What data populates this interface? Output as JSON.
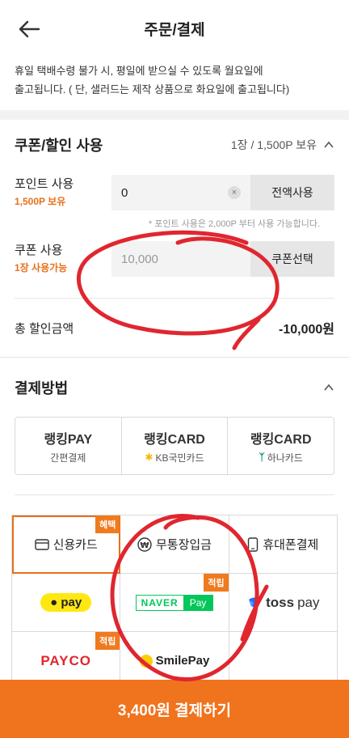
{
  "header": {
    "title": "주문/결제"
  },
  "notice": {
    "line1": "휴일 택배수령 불가 시, 평일에 받으실 수 있도록 월요일에",
    "line2": "출고됩니다. ( 단, 샐러드는 제작 상품으로 화요일에 출고됩니다)"
  },
  "coupon": {
    "title": "쿠폰/할인 사용",
    "summary": "1장 / 1,500P 보유",
    "point_label": "포인트 사용",
    "point_owned": "1,500P 보유",
    "point_value": "0",
    "point_all_button": "전액사용",
    "point_hint": "* 포인트 사용은 2,000P 부터 사용 가능합니다.",
    "coupon_label": "쿠폰 사용",
    "coupon_owned": "1장 사용가능",
    "coupon_placeholder": "10,000",
    "coupon_select_button": "쿠폰선택",
    "total_label": "총 할인금액",
    "total_value": "-10,000원"
  },
  "payment": {
    "title": "결제방법",
    "easy": [
      {
        "brand": "랭킹PAY",
        "sub": "간편결제"
      },
      {
        "brand": "랭킹CARD",
        "sub": "KB국민카드"
      },
      {
        "brand": "랭킹CARD",
        "sub": "하나카드"
      }
    ],
    "methods": {
      "credit_card": "신용카드",
      "credit_tag": "혜택",
      "bank": "무통장입금",
      "phone": "휴대폰결제",
      "kakao": "pay",
      "naver_brand": "NAVER",
      "naver_pay": "Pay",
      "naver_tag": "적립",
      "toss": "toss",
      "toss_pay": "pay",
      "payco": "PAYCO",
      "payco_tag": "적립",
      "smile": "SmilePay"
    }
  },
  "cta": {
    "label": "3,400원 결제하기"
  },
  "colors": {
    "accent": "#f0731e",
    "annotation": "#e0262f"
  }
}
